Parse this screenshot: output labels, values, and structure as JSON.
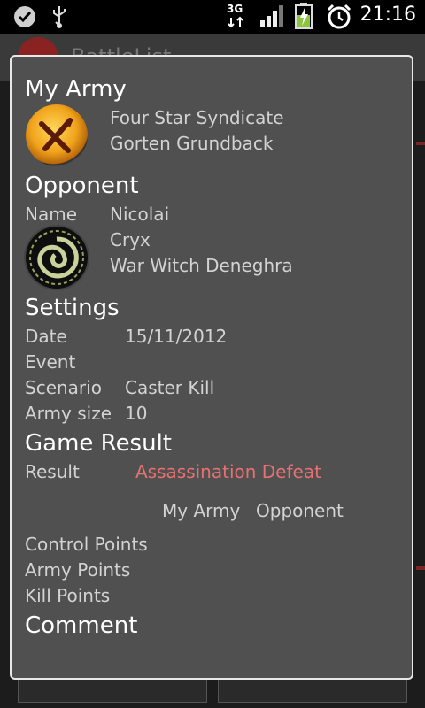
{
  "status_bar": {
    "network": "3G",
    "time": "21:16"
  },
  "app": {
    "title": "BattleList"
  },
  "dialog": {
    "my_army": {
      "heading": "My Army",
      "faction_icon": "mercenary-faction-icon",
      "list_name": "Four Star Syndicate",
      "warcaster": "Gorten Grundback"
    },
    "opponent": {
      "heading": "Opponent",
      "name_label": "Name",
      "name_value": "Nicolai",
      "faction_icon": "cryx-faction-icon",
      "faction": "Cryx",
      "warcaster": "War Witch Deneghra"
    },
    "settings": {
      "heading": "Settings",
      "rows": [
        {
          "label": "Date",
          "value": "15/11/2012"
        },
        {
          "label": "Event",
          "value": ""
        },
        {
          "label": "Scenario",
          "value": "Caster Kill"
        },
        {
          "label": "Army size",
          "value": "10"
        }
      ]
    },
    "game_result": {
      "heading": "Game Result",
      "result_label": "Result",
      "result_value": "Assassination Defeat",
      "result_color": "#e87070",
      "col_my_army": "My Army",
      "col_opponent": "Opponent",
      "rows": [
        {
          "label": "Control Points"
        },
        {
          "label": "Army Points"
        },
        {
          "label": "Kill Points"
        }
      ]
    },
    "comment": {
      "heading": "Comment"
    }
  }
}
